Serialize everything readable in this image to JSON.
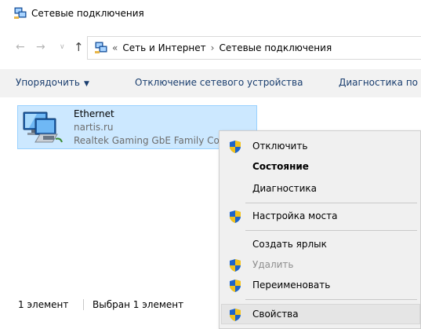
{
  "window": {
    "title": "Сетевые подключения"
  },
  "navigation": {
    "back_icon": "arrow-left-icon",
    "forward_icon": "arrow-right-icon",
    "up_icon": "arrow-up-icon",
    "breadcrumb_overflow": "«",
    "breadcrumb": [
      "Сеть и Интернет",
      "Сетевые подключения"
    ]
  },
  "toolbar": {
    "organize_label": "Упорядочить",
    "disable_label": "Отключение сетевого устройства",
    "diagnose_label": "Диагностика по"
  },
  "connection": {
    "name": "Ethernet",
    "network": "nartis.ru",
    "adapter": "Realtek Gaming GbE Family Co"
  },
  "status": {
    "count": "1 элемент",
    "selected": "Выбран 1 элемент"
  },
  "context_menu": {
    "disable": "Отключить",
    "status": "Состояние",
    "diagnostics": "Диагностика",
    "bridge": "Настройка моста",
    "shortcut": "Создать ярлык",
    "delete": "Удалить",
    "rename": "Переименовать",
    "properties": "Свойства"
  },
  "colors": {
    "selection": "#cce8ff",
    "toolbar_text": "#1a3e6f",
    "menu_bg": "#f0f0f0"
  }
}
